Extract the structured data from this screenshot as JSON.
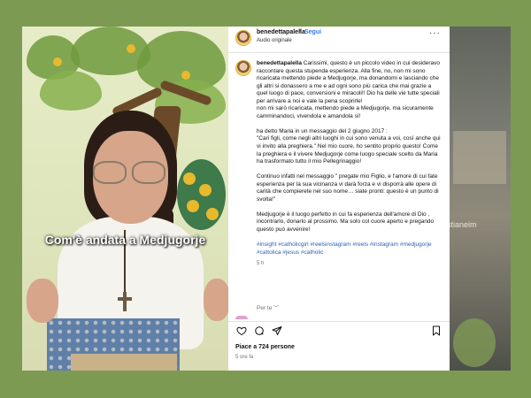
{
  "post": {
    "username": "benedettapalella",
    "separator": "•",
    "follow_label": "Segui",
    "audio_label": "Audio originale",
    "more_label": "···"
  },
  "video": {
    "caption": "Com'è andata a Medjugorje"
  },
  "background_overlay_text": "ristianeim",
  "caption": {
    "author": "benedettapalella",
    "p1": "Carissimi, questo è un piccolo video in cui desideravo raccontare questa stupenda esperienza. Alla fine, no, non mi sono ricaricata mettendo piede a Medjugorje, ma donandomi e lasciando che gli altri si donassero a me e ad ogni sono più carica che mai grazie a quel luogo di pace, conversioni e miracoli!! Dio ha delle vie tutte speciali per arrivare a noi e vale la pena scoprirle!\nnon mi sarò ricaricata, mettendo piede a Medjugorje, ma sicuramente camminandoci, vivendola e amandola sì!",
    "p2": "ha detto Maria in un messaggio del 2 giugno 2017 :\n\"Cari figli, come negli altri luoghi in cui sono venuta a voi, così anche qui vi invito alla preghiera.\" Nel mio cuore, ho sentito proprio questo! Come la preghiera e il vivere Medjugorje come luogo speciale scelto da Maria ha trasformato tutto il mio Pellegrinaggio!",
    "p3": "Continuo infatti nel messaggio \" pregate mio Figlio, e l'amore di cui fate esperienza per la sua vicinanza vi darà forza e vi disporrà alle opere di carità che compierete nel suo nome… siate pronti: questo è un punto di svolta!\"",
    "p4": "Medjugorje è il luogo perfetto in cui fa esperienza dell'amore di Dio , incontrarlo, donarlo al prossimo. Ma solo col cuore aperto e pregando questo può avvenire!",
    "hashtags": "#insight #catholicgirl #reelsinstagram #reels #instagram #medjugorje #cattolica #jesus #catholic",
    "time": "5 h"
  },
  "comments": {
    "translate_label": "Per te",
    "chevron": "﹀"
  },
  "actions": {
    "like_icon": "heart-icon",
    "comment_icon": "comment-icon",
    "share_icon": "share-icon",
    "save_icon": "bookmark-icon"
  },
  "likes_text": "Piace a 724 persone",
  "posted_ago": "5 ore fa",
  "colors": {
    "page_bg": "#7d9a52",
    "follow": "#2f7cf6",
    "hashtag": "#2b61b5"
  }
}
